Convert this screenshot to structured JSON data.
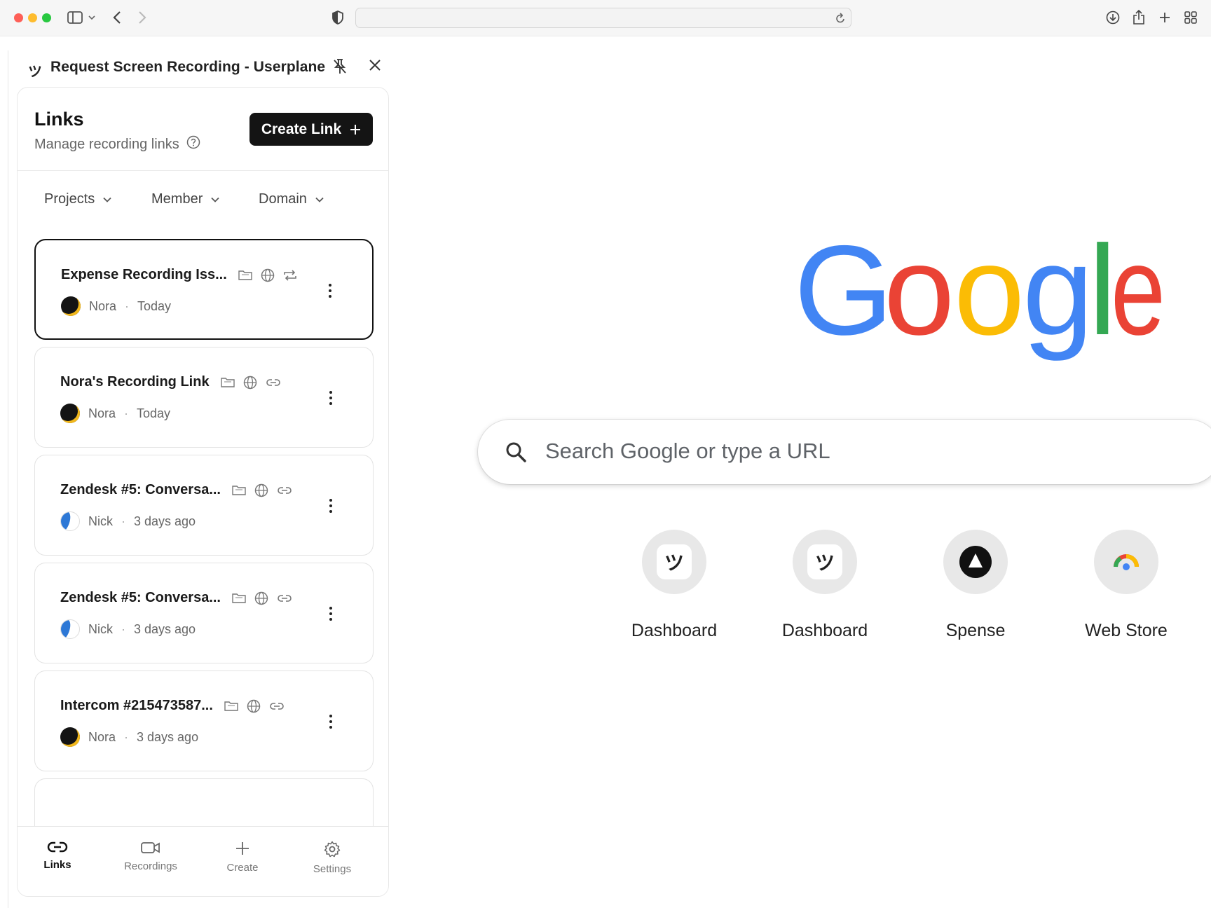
{
  "browser": {
    "address_value": "",
    "icons": [
      "sidebar-icon",
      "chevron-down-icon",
      "back-icon",
      "forward-icon",
      "shield-icon",
      "reload-icon",
      "download-icon",
      "share-icon",
      "new-tab-icon",
      "tab-overview-icon"
    ]
  },
  "panel": {
    "logo": "ツ",
    "title": "Request Screen Recording - Userplane",
    "header": {
      "title": "Links",
      "subtitle": "Manage recording links",
      "create_button": "Create Link"
    },
    "filters": [
      "Projects",
      "Member",
      "Domain"
    ],
    "links": [
      {
        "title": "Expense Recording Iss...",
        "user": "Nora",
        "time": "Today",
        "type": "repeat",
        "selected": true
      },
      {
        "title": "Nora's Recording Link",
        "user": "Nora",
        "time": "Today",
        "type": "link",
        "selected": false
      },
      {
        "title": "Zendesk #5: Conversa...",
        "user": "Nick",
        "time": "3 days ago",
        "type": "link",
        "selected": false
      },
      {
        "title": "Zendesk #5: Conversa...",
        "user": "Nick",
        "time": "3 days ago",
        "type": "link",
        "selected": false
      },
      {
        "title": "Intercom #215473587...",
        "user": "Nora",
        "time": "3 days ago",
        "type": "link",
        "selected": false
      }
    ],
    "nav": [
      {
        "label": "Links",
        "icon": "link-icon",
        "active": true
      },
      {
        "label": "Recordings",
        "icon": "video-icon",
        "active": false
      },
      {
        "label": "Create",
        "icon": "plus-icon",
        "active": false
      },
      {
        "label": "Settings",
        "icon": "gear-icon",
        "active": false
      }
    ]
  },
  "newtab": {
    "logo_letters": [
      "G",
      "o",
      "o",
      "g",
      "l",
      "e"
    ],
    "logo_colors": [
      "#4285f4",
      "#ea4335",
      "#fbbc05",
      "#4285f4",
      "#34a853",
      "#ea4335"
    ],
    "search_placeholder": "Search Google or type a URL",
    "shortcuts": [
      {
        "label": "Dashboard",
        "glyph": "ツ"
      },
      {
        "label": "Dashboard",
        "glyph": "ツ"
      },
      {
        "label": "Spense",
        "glyph": ""
      },
      {
        "label": "Web Store",
        "glyph": ""
      }
    ]
  }
}
